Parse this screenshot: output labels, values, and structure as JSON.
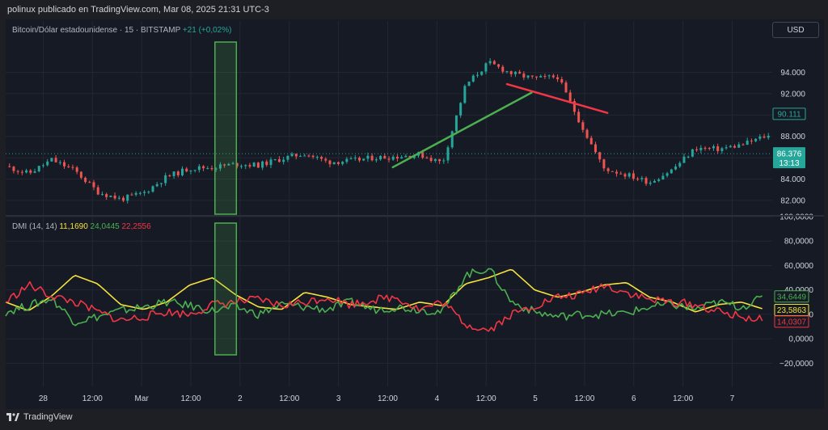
{
  "header": {
    "publisher": "polinux publicado en TradingView.com, Mar 08, 2025 21:31 UTC-3"
  },
  "symbol": {
    "name": "Bitcoin/Dólar estadounidense · 15 · BITSTAMP",
    "change": "+21 (+0,02%)"
  },
  "currency_button": "USD",
  "indicator": {
    "name": "DMI (14, 14)",
    "adx": "11,1690",
    "plus_di": "24,0445",
    "minus_di": "22,2556"
  },
  "footer": {
    "brand": "TradingView"
  },
  "colors": {
    "adx": "#f5e33b",
    "plus_di": "#4caf50",
    "minus_di": "#f23645",
    "up": "#26a69a",
    "down": "#ef5350",
    "box": "#4caf50"
  },
  "chart_data": [
    {
      "type": "line",
      "name": "price",
      "x_ticks": [
        "28",
        "12:00",
        "Mar",
        "12:00",
        "2",
        "12:00",
        "3",
        "12:00",
        "4",
        "12:00",
        "5",
        "12:00",
        "6",
        "12:00",
        "7"
      ],
      "y_ticks": [
        "94.000",
        "92.000",
        "90.000",
        "88.000",
        "86.000",
        "84.000",
        "82.000"
      ],
      "ylim": [
        80700,
        97300
      ],
      "x": [
        0,
        3,
        6,
        9,
        12,
        15,
        18,
        21,
        24,
        27,
        30,
        33,
        36,
        39,
        42,
        45,
        48,
        51,
        54,
        57,
        60,
        63,
        66,
        69,
        72,
        75,
        78,
        81,
        84,
        87,
        90,
        93,
        96,
        99
      ],
      "values": [
        85200,
        84500,
        85800,
        84800,
        82800,
        82100,
        82700,
        84200,
        85000,
        85100,
        85400,
        85300,
        85900,
        86400,
        85600,
        85700,
        86000,
        86100,
        86300,
        85500,
        92800,
        94900,
        93900,
        93400,
        93600,
        89200,
        85000,
        84400,
        83700,
        84900,
        86900,
        86800,
        87200,
        88000
      ],
      "reference_lines": [
        {
          "label": "86.376",
          "value": 86376,
          "sublabel": "13:13"
        },
        {
          "label": "90.111",
          "value": 90111
        }
      ],
      "trendlines": [
        {
          "color": "#4caf50",
          "from": [
            50.5,
            85100
          ],
          "to": [
            68.6,
            92100
          ]
        },
        {
          "color": "#f23645",
          "from": [
            65.4,
            92900
          ],
          "to": [
            78.5,
            90200
          ]
        }
      ]
    },
    {
      "type": "line",
      "name": "DMI (14, 14)",
      "y_ticks": [
        "100,0000",
        "80,0000",
        "60,0000",
        "40,0000",
        "20,0000",
        "0,0000",
        "−20,0000"
      ],
      "ylim": [
        -35,
        100
      ],
      "x": [
        0,
        3,
        6,
        9,
        12,
        15,
        18,
        21,
        24,
        27,
        30,
        33,
        36,
        39,
        42,
        45,
        48,
        51,
        54,
        57,
        60,
        63,
        66,
        69,
        72,
        75,
        78,
        81,
        84,
        87,
        90,
        93,
        96,
        99
      ],
      "series": [
        {
          "name": "ADX",
          "values": [
            30,
            23,
            35,
            52,
            45,
            28,
            24,
            30,
            44,
            50,
            36,
            26,
            24,
            38,
            34,
            28,
            26,
            24,
            30,
            27,
            45,
            50,
            57,
            40,
            34,
            38,
            44,
            46,
            34,
            30,
            22,
            28,
            30,
            24
          ]
        },
        {
          "name": "+DI",
          "values": [
            22,
            27,
            33,
            14,
            18,
            23,
            26,
            30,
            27,
            23,
            26,
            20,
            28,
            26,
            24,
            30,
            24,
            26,
            24,
            22,
            52,
            58,
            30,
            22,
            18,
            20,
            20,
            21,
            26,
            28,
            24,
            30,
            26,
            34
          ]
        },
        {
          "name": "−DI",
          "values": [
            30,
            44,
            35,
            30,
            22,
            15,
            18,
            22,
            20,
            28,
            30,
            32,
            27,
            30,
            34,
            28,
            32,
            34,
            24,
            30,
            12,
            7,
            20,
            27,
            34,
            36,
            44,
            38,
            32,
            30,
            28,
            22,
            18,
            15
          ]
        }
      ],
      "last_labels": [
        {
          "label": "34,6449",
          "value": 34.6449,
          "color": "#4caf50"
        },
        {
          "label": "23,5863",
          "value": 23.5863,
          "color": "#f5e33b"
        },
        {
          "label": "14,0307",
          "value": 14.0307,
          "color": "#f23645"
        }
      ]
    }
  ],
  "highlight_box": {
    "x_start": 27.3,
    "x_end": 30.1
  }
}
